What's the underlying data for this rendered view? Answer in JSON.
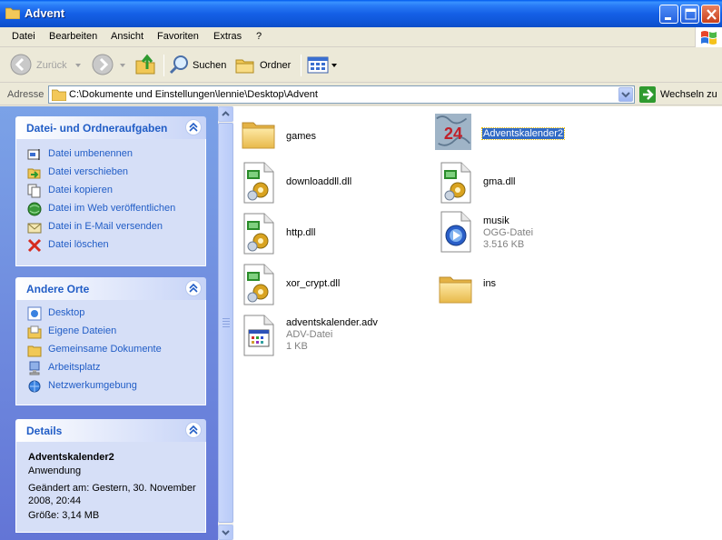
{
  "window": {
    "title": "Advent"
  },
  "menu": [
    "Datei",
    "Bearbeiten",
    "Ansicht",
    "Favoriten",
    "Extras",
    "?"
  ],
  "toolbar": {
    "back_label": "Zurück",
    "search_label": "Suchen",
    "folders_label": "Ordner"
  },
  "address": {
    "label": "Adresse",
    "path": "C:\\Dokumente und Einstellungen\\lennie\\Desktop\\Advent",
    "go_label": "Wechseln zu"
  },
  "tasks": {
    "title": "Datei- und Ordneraufgaben",
    "items": [
      {
        "label": "Datei umbenennen",
        "icon": "rename-icon"
      },
      {
        "label": "Datei verschieben",
        "icon": "move-icon"
      },
      {
        "label": "Datei kopieren",
        "icon": "copy-icon"
      },
      {
        "label": "Datei im Web veröffentlichen",
        "icon": "publish-web-icon"
      },
      {
        "label": "Datei in E-Mail versenden",
        "icon": "email-icon"
      },
      {
        "label": "Datei löschen",
        "icon": "delete-icon"
      }
    ]
  },
  "places": {
    "title": "Andere Orte",
    "items": [
      {
        "label": "Desktop",
        "icon": "desktop-icon"
      },
      {
        "label": "Eigene Dateien",
        "icon": "my-documents-icon"
      },
      {
        "label": "Gemeinsame Dokumente",
        "icon": "shared-documents-icon"
      },
      {
        "label": "Arbeitsplatz",
        "icon": "my-computer-icon"
      },
      {
        "label": "Netzwerkumgebung",
        "icon": "network-icon"
      }
    ]
  },
  "details": {
    "title": "Details",
    "name": "Adventskalender2",
    "type": "Anwendung",
    "modified": "Geändert am: Gestern, 30. November 2008, 20:44",
    "size": "Größe: 3,14 MB"
  },
  "files": [
    {
      "name": "games",
      "icon": "folder-icon"
    },
    {
      "name": "Adventskalender2",
      "icon": "calendar-app-icon",
      "selected": true
    },
    {
      "name": "downloaddll.dll",
      "icon": "dll-icon"
    },
    {
      "name": "gma.dll",
      "icon": "dll-icon"
    },
    {
      "name": "http.dll",
      "icon": "dll-icon"
    },
    {
      "name": "musik",
      "type": "OGG-Datei",
      "size": "3.516 KB",
      "icon": "media-file-icon"
    },
    {
      "name": "xor_crypt.dll",
      "icon": "dll-icon"
    },
    {
      "name": "ins",
      "icon": "folder-icon"
    },
    {
      "name": "adventskalender.adv",
      "type": "ADV-Datei",
      "size": "1 KB",
      "icon": "document-icon"
    }
  ]
}
